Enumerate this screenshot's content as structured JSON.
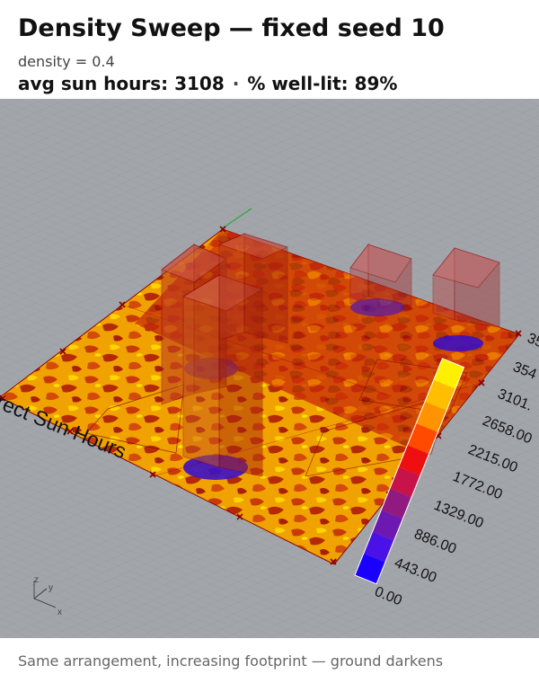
{
  "header": {
    "title": "Density Sweep — fixed seed 10",
    "subtitle": "density = 0.4",
    "avg_sun_label": "avg sun hours: 3108",
    "separator": "·",
    "well_lit_label": "% well-lit: 89%"
  },
  "viewport": {
    "analysis_label": "Direct Sun Hours",
    "axis_labels": {
      "x": "x",
      "y": "y",
      "z": "z"
    }
  },
  "legend": {
    "ticks": [
      "0.00",
      "443.00",
      "886.00",
      "1329.00",
      "1772.00",
      "2215.00",
      "2658.00",
      "3101.",
      "354",
      "35"
    ],
    "colors": [
      "#1a00ff",
      "#4a12e6",
      "#6d18b0",
      "#901a80",
      "#c8124a",
      "#ee1010",
      "#ff4a00",
      "#ff9400",
      "#ffbf00",
      "#fff000"
    ]
  },
  "caption": "Same arrangement, increasing footprint — ground darkens"
}
